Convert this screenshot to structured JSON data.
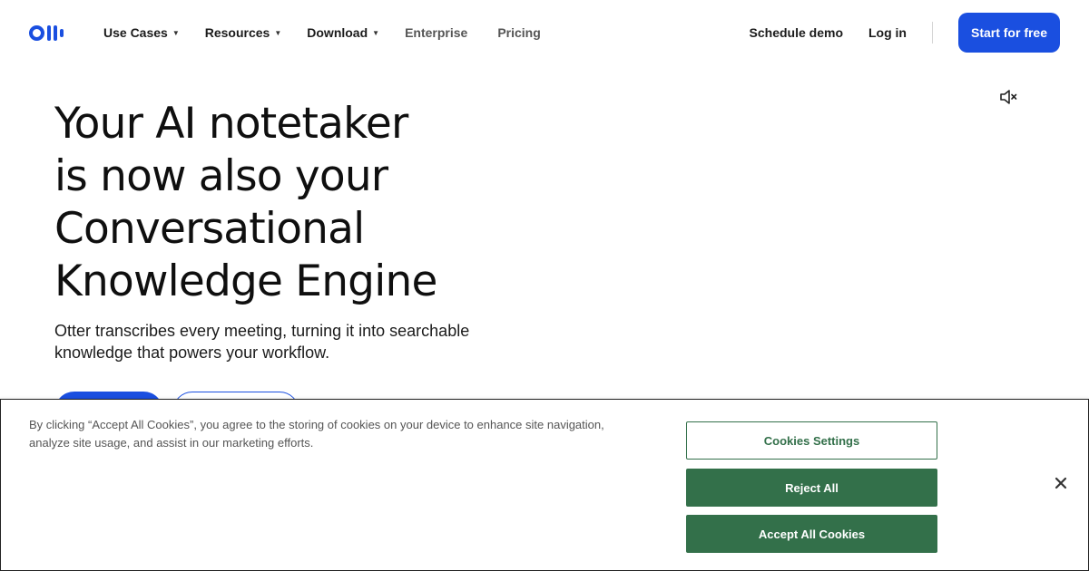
{
  "header": {
    "logo_icon": "otter-logo-icon",
    "nav": [
      {
        "label": "Use Cases",
        "has_dropdown": true
      },
      {
        "label": "Resources",
        "has_dropdown": true
      },
      {
        "label": "Download",
        "has_dropdown": true
      },
      {
        "label": "Enterprise",
        "has_dropdown": false
      },
      {
        "label": "Pricing",
        "has_dropdown": false
      }
    ],
    "caret": "▼",
    "schedule_demo": "Schedule demo",
    "login": "Log in",
    "start_free": "Start for free"
  },
  "hero": {
    "mute_icon": "speaker-muted-icon",
    "title_lines": [
      "Your AI notetaker",
      "is now also your",
      "Conversational",
      "Knowledge Engine"
    ],
    "subtitle_lines": [
      "Otter transcribes every meeting, turning it into searchable",
      "knowledge that powers your workflow."
    ]
  },
  "cookie_banner": {
    "text_lines": [
      "By clicking “Accept All Cookies”, you agree to the storing of cookies on your device to enhance site navigation,",
      "analyze site usage, and assist in our marketing efforts."
    ],
    "settings_label": "Cookies Settings",
    "reject_label": "Reject All",
    "accept_label": "Accept All Cookies",
    "close_icon": "close-icon"
  },
  "colors": {
    "brand_blue": "#1a4fe0",
    "cookie_green": "#33704a"
  }
}
